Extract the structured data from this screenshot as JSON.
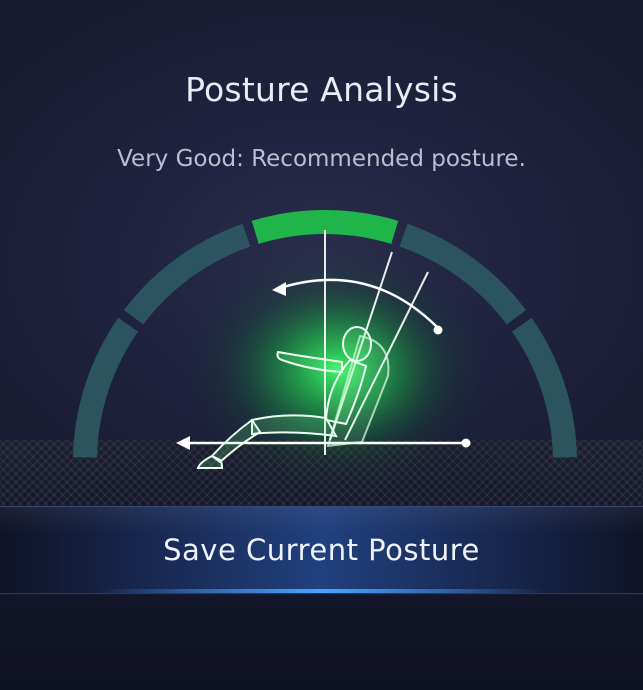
{
  "header": {
    "title": "Posture Analysis",
    "status_text": "Very Good: Recommended posture."
  },
  "gauge": {
    "segments_total": 5,
    "active_segment": 3,
    "colors": {
      "inactive": "#2e5a64",
      "active": "#1fb54a",
      "figure_glow": "#27e05a",
      "guide_lines": "#ffffff"
    },
    "icons": [
      "seated-figure-icon",
      "recline-angle-arc-icon",
      "horizontal-adjust-arrow-icon"
    ]
  },
  "actions": {
    "save_label": "Save Current Posture"
  }
}
